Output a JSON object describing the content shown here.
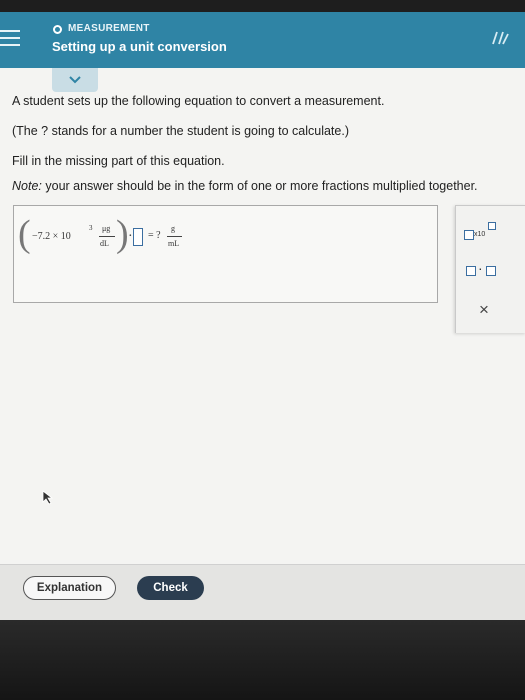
{
  "header": {
    "topic": "MEASUREMENT",
    "title": "Setting up a unit conversion"
  },
  "question": {
    "line1": "A student sets up the following equation to convert a measurement.",
    "line2": "(The ? stands for a number the student is going to calculate.)",
    "line3": "Fill in the missing part of this equation.",
    "note_label": "Note:",
    "note_text": " your answer should be in the form of one or more fractions multiplied together."
  },
  "equation": {
    "coefficient": "−7.2 × 10",
    "exponent": "3",
    "unit_num": "μg",
    "unit_den": "dL",
    "dot": "·",
    "equals": "= ?",
    "result_num": "g",
    "result_den": "mL"
  },
  "palette": {
    "sci_label": "x10",
    "dot_label": "·",
    "close_label": "×"
  },
  "buttons": {
    "explanation": "Explanation",
    "check": "Check"
  },
  "colors": {
    "header": "#2f84a5",
    "check_button": "#2b3d50",
    "answer_slot_border": "#3b6ea0"
  }
}
